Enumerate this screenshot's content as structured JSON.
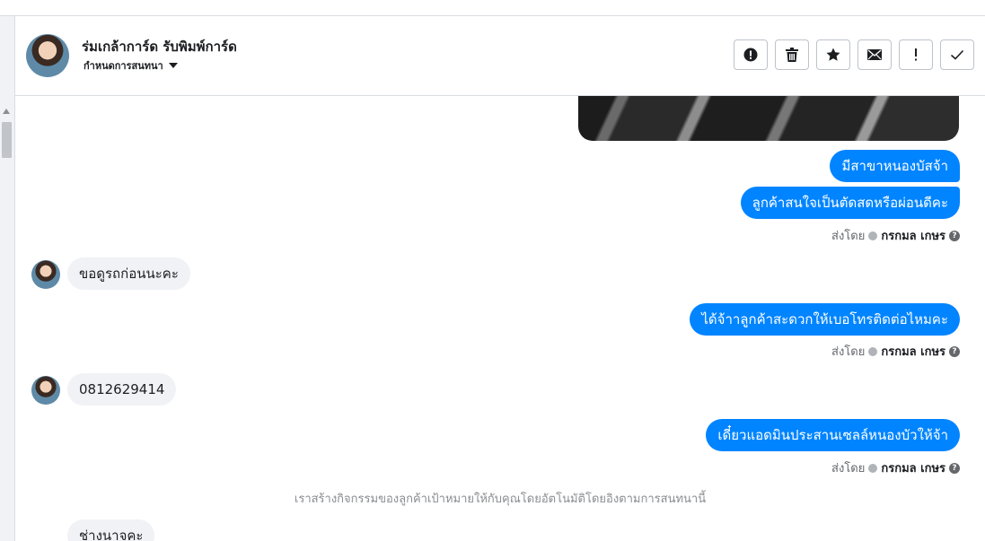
{
  "header": {
    "contact_name": "ร่มเกล้าการ์ด รับพิมพ์การ์ด",
    "assign_label": "กำหนดการสนทนา",
    "actions": [
      {
        "name": "report-spam-button",
        "icon": "alert-circle-icon"
      },
      {
        "name": "delete-button",
        "icon": "trash-icon"
      },
      {
        "name": "star-button",
        "icon": "star-icon"
      },
      {
        "name": "mark-unread-button",
        "icon": "envelope-icon"
      },
      {
        "name": "follow-up-button",
        "icon": "exclamation-icon"
      },
      {
        "name": "mark-done-button",
        "icon": "check-icon"
      }
    ]
  },
  "messages": {
    "out1": "มีสาขาหนองบัสจ้า",
    "out2": "ลูกค้าสนใจเป็นตัดสดหรือผ่อนดีคะ",
    "in1": "ขอดูรถก่อนนะคะ",
    "out3": "ได้จ้าาลูกค้าสะดวกให้เบอโทรติดต่อไหมคะ",
    "in2": "0812629414",
    "out4": "เดี๋ยวแอดมินประสานเซลล์หนองบัวให้จ้า",
    "in3": "ช่างนาจคะ"
  },
  "sent_by": {
    "label": "ส่งโดย",
    "agent": "กรกมล เกษร"
  },
  "system_note": "เราสร้างกิจกรรมของลูกค้าเป้าหมายให้กับคุณโดยอัตโนมัติโดยอิงตามการสนทนานี้",
  "colors": {
    "outgoing_bubble": "#0084ff",
    "incoming_bubble": "#f0f2f5"
  }
}
